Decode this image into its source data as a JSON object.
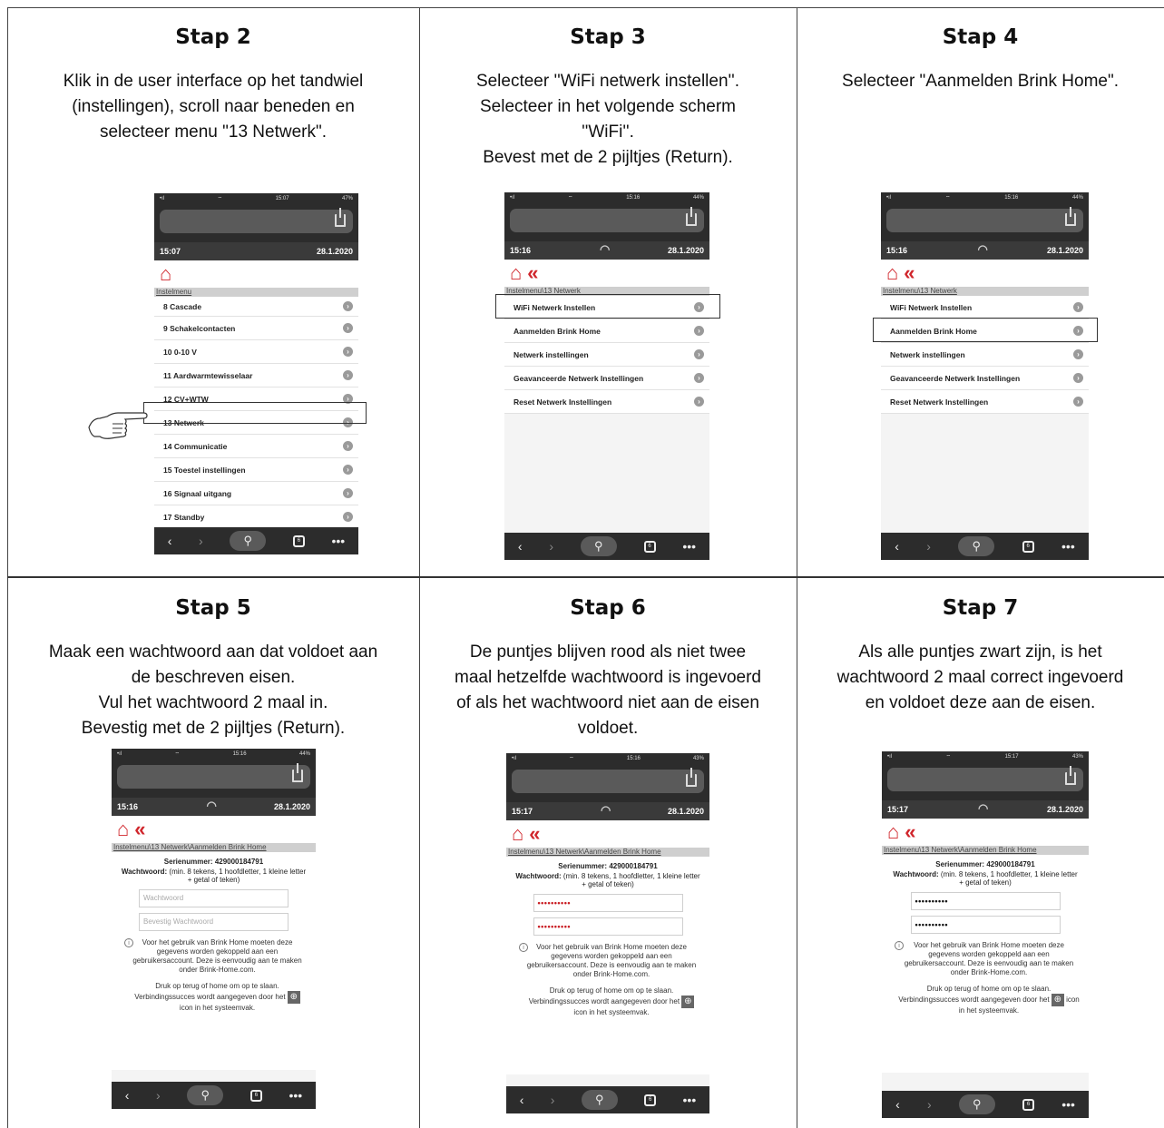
{
  "steps": [
    {
      "title": "Stap 2",
      "desc": "Klik in de user interface op het tandwiel\n(instellingen), scroll naar beneden en\nselecteer menu \"13 Netwerk\".",
      "phone": {
        "status_time": "15:07",
        "status_batt": "47%",
        "top_time": "15:07",
        "top_date": "28.1.2020",
        "crumb": "Instelmenu",
        "items": [
          "8 Cascade",
          "9 Schakelcontacten",
          "10 0-10 V",
          "11 Aardwarmtewisselaar",
          "12 CV+WTW",
          "13 Netwerk",
          "14 Communicatie",
          "15 Toestel instellingen",
          "16 Signaal uitgang",
          "17 Standby"
        ]
      }
    },
    {
      "title": "Stap 3",
      "desc": "Selecteer ''WiFi netwerk instellen''.\nSelecteer in het volgende scherm\n''WiFi''.\nBevest met de 2 pijltjes (Return).",
      "phone": {
        "status_time": "15:16",
        "status_batt": "44%",
        "top_time": "15:16",
        "top_date": "28.1.2020",
        "crumb": "Instelmenu\\13 Netwerk",
        "items": [
          "WiFi Netwerk Instellen",
          "Aanmelden Brink Home",
          "Netwerk instellingen",
          "Geavanceerde Netwerk Instellingen",
          "Reset Netwerk Instellingen"
        ]
      }
    },
    {
      "title": "Stap 4",
      "desc": "Selecteer \"Aanmelden Brink Home\".",
      "phone": {
        "status_time": "15:16",
        "status_batt": "44%",
        "top_time": "15:16",
        "top_date": "28.1.2020",
        "crumb": "Instelmenu\\13 Netwerk",
        "items": [
          "WiFi Netwerk Instellen",
          "Aanmelden Brink Home",
          "Netwerk instellingen",
          "Geavanceerde Netwerk Instellingen",
          "Reset Netwerk Instellingen"
        ]
      }
    },
    {
      "title": "Stap 5",
      "desc": "Maak een wachtwoord aan dat voldoet aan\nde beschreven eisen.\nVul het wachtwoord 2 maal in.\nBevestig met de 2 pijltjes (Return).",
      "phone": {
        "status_time": "15:16",
        "status_batt": "44%",
        "top_time": "15:16",
        "top_date": "28.1.2020",
        "crumb": "Instelmenu\\13 Netwerk\\Aanmelden Brink Home",
        "pw1": "Wachtwoord",
        "pw2": "Bevestig Wachtwoord"
      }
    },
    {
      "title": "Stap 6",
      "desc": "De puntjes blijven rood als niet twee\nmaal hetzelfde wachtwoord is ingevoerd\nof als het wachtwoord niet aan de eisen\nvoldoet.",
      "phone": {
        "status_time": "15:16",
        "status_batt": "43%",
        "top_time": "15:17",
        "top_date": "28.1.2020",
        "crumb": "Instelmenu\\13 Netwerk\\Aanmelden Brink Home",
        "pw1": "••••••••••",
        "pw2": "••••••••••"
      }
    },
    {
      "title": "Stap 7",
      "desc": "Als alle puntjes zwart zijn, is het\nwachtwoord 2 maal correct ingevoerd\nen voldoet deze aan de eisen.",
      "phone": {
        "status_time": "15:17",
        "status_batt": "43%",
        "top_time": "15:17",
        "top_date": "28.1.2020",
        "crumb": "Instelmenu\\13 Netwerk\\Aanmelden Brink Home",
        "pw1": "••••••••••",
        "pw2": "••••••••••"
      }
    }
  ],
  "pwscreen": {
    "serial_label": "Serienummer:",
    "serial_value": "429000184791",
    "pw_label": "Wachtwoord:",
    "pw_rules": "(min. 8 tekens, 1 hoofdletter, 1 kleine letter + getal of teken)",
    "info1": "Voor het gebruik van Brink Home moeten deze gegevens worden gekoppeld aan een gebruikersaccount. Deze is eenvoudig aan te maken onder Brink-Home.com.",
    "info2a": "Druk op terug of home om op te slaan. Verbindingssucces wordt aangegeven door het",
    "info2b": "icon in het systeemvak."
  },
  "colors": {
    "accent_red": "#d0262c",
    "phone_dark": "#2c2c2c"
  },
  "icons": [
    "home-icon",
    "double-chevron-left-icon",
    "wifi-icon",
    "chevron-right-icon",
    "share-icon",
    "search-icon",
    "tabs-icon",
    "more-icon",
    "pointing-hand-icon",
    "info-icon",
    "globe-icon"
  ]
}
